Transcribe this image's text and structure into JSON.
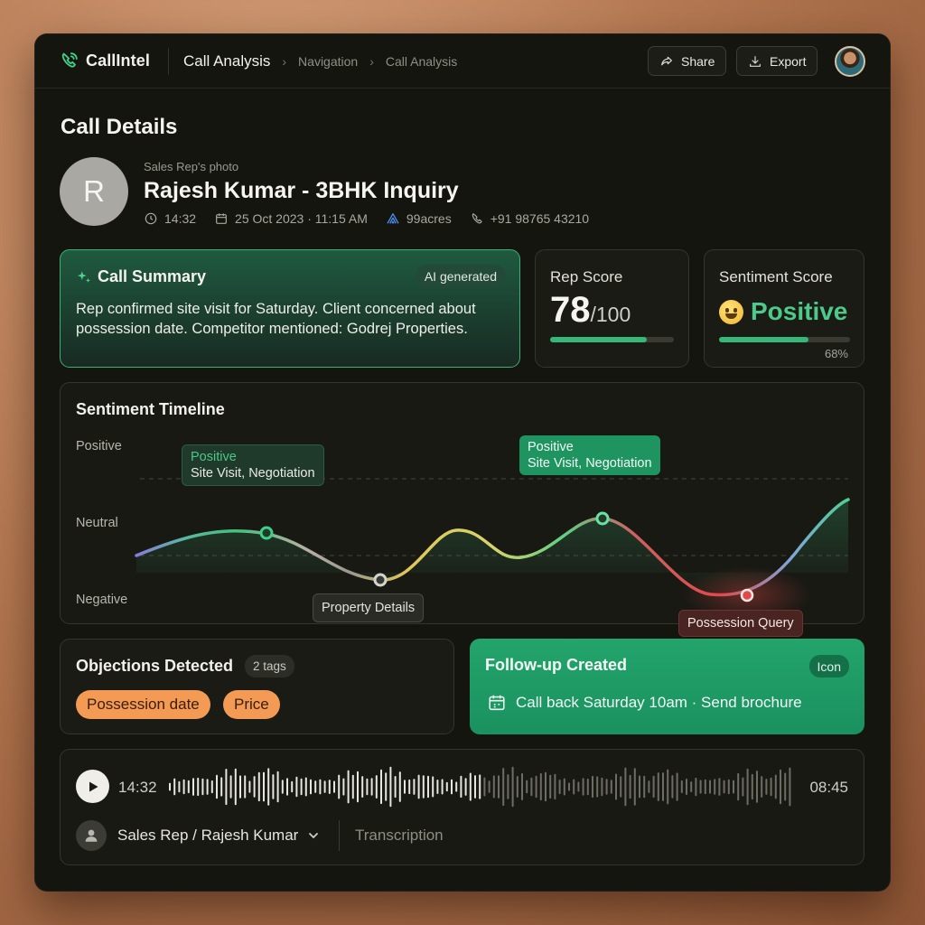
{
  "header": {
    "logo_text": "CallIntel",
    "breadcrumb": [
      "Call Analysis",
      "Navigation",
      "Call Analysis"
    ],
    "share_label": "Share",
    "export_label": "Export"
  },
  "call": {
    "section_title": "Call Details",
    "avatar_initial": "R",
    "photo_label": "Sales Rep's photo",
    "title": "Rajesh Kumar - 3BHK Inquiry",
    "duration": "14:32",
    "datetime": "25 Oct 2023 · 11:15 AM",
    "source": "99acres",
    "phone": "+91 98765 43210"
  },
  "summary": {
    "title": "Call Summary",
    "badge": "AI generated",
    "text": "Rep confirmed site visit for Saturday. Client concerned about possession date. Competitor mentioned: Godrej Properties."
  },
  "rep_score": {
    "label": "Rep Score",
    "value": "78",
    "max": "/100",
    "fraction": 0.78
  },
  "sentiment_score": {
    "label": "Sentiment Score",
    "value": "Positive",
    "percent": "68%",
    "fraction": 0.68
  },
  "timeline": {
    "title": "Sentiment Timeline",
    "levels": [
      "Positive",
      "Neutral",
      "Negative"
    ],
    "markers": [
      {
        "sentiment": "Positive",
        "label": "Site Visit, Negotiation"
      },
      {
        "label": "Property Details"
      },
      {
        "sentiment": "Positive",
        "label": "Site Visit, Negotiation"
      },
      {
        "label": "Possession Query"
      }
    ]
  },
  "objections": {
    "title": "Objections Detected",
    "count": "2 tags",
    "tags": [
      "Possession date",
      "Price"
    ]
  },
  "followup": {
    "title": "Follow-up Created",
    "badge": "Icon",
    "text": "Call back Saturday 10am · Send brochure"
  },
  "audio": {
    "current_time": "14:32",
    "end_time": "08:45",
    "played_fraction": 0.5,
    "speaker": "Sales Rep / Rajesh Kumar",
    "transcription_label": "Transcription"
  },
  "colors": {
    "accent_green": "#33b878",
    "followup_green": "#1f9c66",
    "objection_orange": "#f39a55",
    "negative_red": "#e0504a"
  }
}
